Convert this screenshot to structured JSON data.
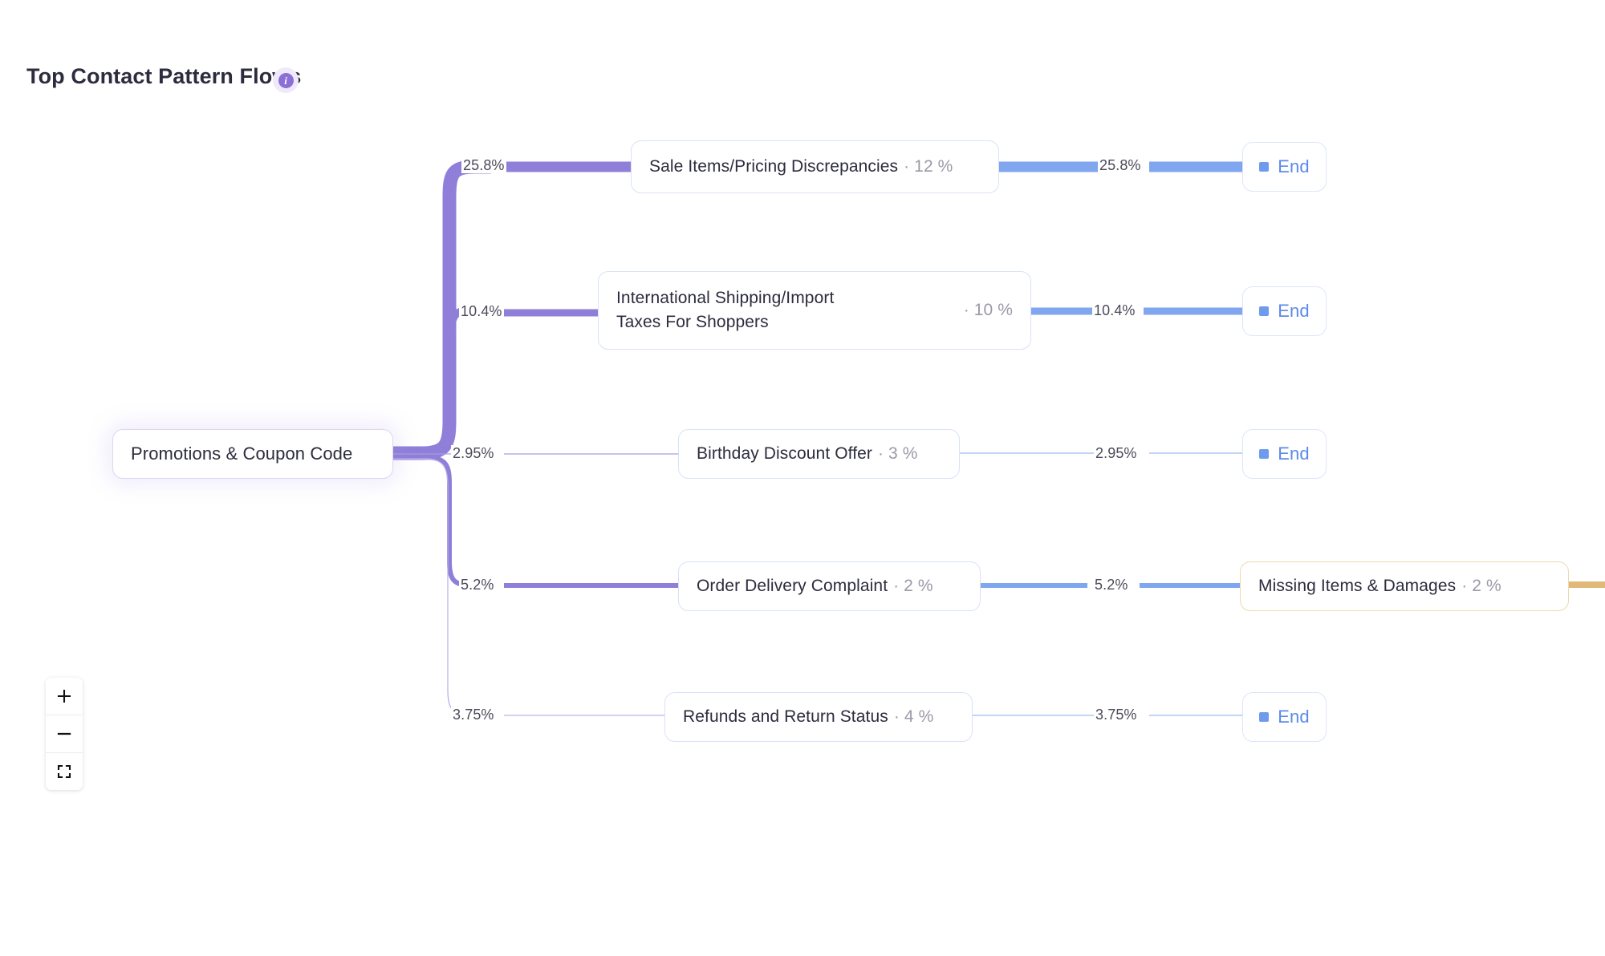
{
  "header": {
    "title": "Top Contact Pattern Flows",
    "info_icon": "info-icon",
    "info_glyph": "i"
  },
  "accent_colors": {
    "purple_link": "#8f7fd9",
    "blue_link": "#7fa6ee",
    "orange_link": "#e0b878",
    "node_border": "#d9e2f7",
    "root_border": "#ded5f6",
    "orange_border": "#eed9b1",
    "end_text": "#5b8ae8",
    "info_badge": "#8b6fd6",
    "title_text": "#2c2c3e",
    "pct_text": "#9a9aa8"
  },
  "root": {
    "label": "Promotions & Coupon Code"
  },
  "flows": [
    {
      "in_pct": "25.8%",
      "node_label": "Sale Items/Pricing Discrepancies",
      "node_pct": "· 12 %",
      "out_pct": "25.8%",
      "end_label": "End"
    },
    {
      "in_pct": "10.4%",
      "node_label": "International Shipping/Import Taxes For Shoppers",
      "node_pct": "· 10 %",
      "out_pct": "10.4%",
      "end_label": "End"
    },
    {
      "in_pct": "2.95%",
      "node_label": "Birthday Discount Offer",
      "node_pct": "· 3 %",
      "out_pct": "2.95%",
      "end_label": "End"
    },
    {
      "in_pct": "5.2%",
      "node_label": "Order Delivery Complaint",
      "node_pct": "· 2 %",
      "out_pct": "5.2%",
      "end_label": "Missing Items & Damages",
      "end_pct": "· 2 %"
    },
    {
      "in_pct": "3.75%",
      "node_label": "Refunds and Return Status",
      "node_pct": "· 4 %",
      "out_pct": "3.75%",
      "end_label": "End"
    }
  ],
  "zoom_controls": {
    "zoom_in": "zoom-in-icon",
    "zoom_out": "zoom-out-icon",
    "fit_screen": "fit-screen-icon"
  }
}
